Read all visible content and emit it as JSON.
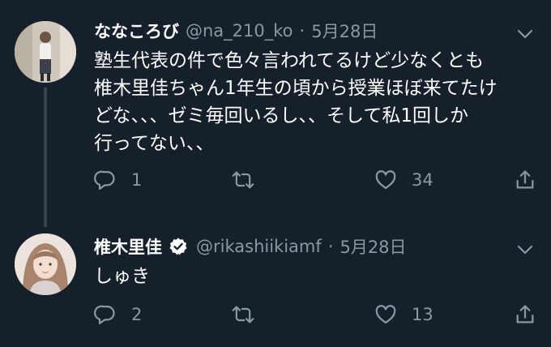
{
  "tweets": [
    {
      "name": "ななころび",
      "handle": "@na_210_ko",
      "separator": "·",
      "date": "5月28日",
      "text": "塾生代表の件で色々言われてるけど少なくとも\n椎木里佳ちゃん1年生の頃から授業ほぼ来てたけ\nどな、、、ゼミ毎回いるし、、そして私1回しか\n行ってない、、",
      "reply_count": "1",
      "retweet_count": "",
      "like_count": "34",
      "verified": false
    },
    {
      "name": "椎木里佳",
      "handle": "@rikashiikiamf",
      "separator": "·",
      "date": "5月28日",
      "text": "しゅき",
      "reply_count": "2",
      "retweet_count": "",
      "like_count": "13",
      "verified": true
    }
  ],
  "colors": {
    "background": "#15202b",
    "secondary_text": "#8899a6",
    "primary_text": "#ffffff",
    "thread_line": "#38444d"
  },
  "icons": [
    "reply-icon",
    "retweet-icon",
    "like-icon",
    "share-icon",
    "verified-badge-icon",
    "chevron-down-icon"
  ]
}
